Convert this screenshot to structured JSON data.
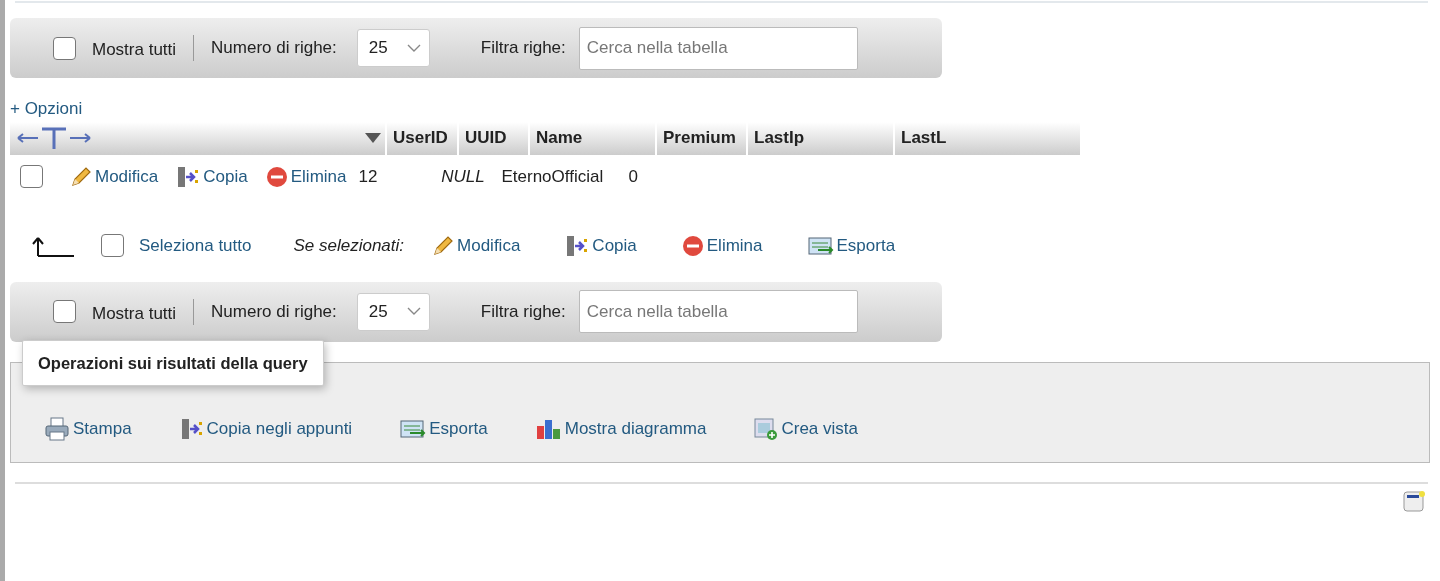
{
  "top_toolbar": {
    "show_all": {
      "label": "Mostra tutti",
      "checked": false
    },
    "rows_label": "Numero di righe:",
    "rows_value": "25",
    "filter_label": "Filtra righe:",
    "filter_placeholder": "Cerca nella tabella"
  },
  "options_link": "+ Opzioni",
  "table": {
    "columns": [
      "UserID",
      "UUID",
      "Name",
      "Premium",
      "LastIp",
      "LastL"
    ],
    "rows": [
      {
        "selected": false,
        "actions": [
          {
            "kind": "edit",
            "label": "Modifica"
          },
          {
            "kind": "copy",
            "label": "Copia"
          },
          {
            "kind": "delete",
            "label": "Elimina"
          }
        ],
        "cells": [
          {
            "text": "12",
            "kind": "value"
          },
          {
            "text": "NULL",
            "kind": "null"
          },
          {
            "text": "EternoOfficial",
            "kind": "value"
          },
          {
            "text": "0",
            "kind": "value"
          }
        ]
      }
    ]
  },
  "bulk_actions": {
    "select_all": {
      "label": "Seleziona tutto",
      "checked": false
    },
    "with_selected": "Se selezionati:",
    "actions": [
      {
        "kind": "edit",
        "label": "Modifica"
      },
      {
        "kind": "copy",
        "label": "Copia"
      },
      {
        "kind": "delete",
        "label": "Elimina"
      },
      {
        "kind": "export",
        "label": "Esporta"
      }
    ]
  },
  "bottom_toolbar": {
    "show_all": {
      "label": "Mostra tutti",
      "checked": false
    },
    "rows_label": "Numero di righe:",
    "rows_value": "25",
    "filter_label": "Filtra righe:",
    "filter_placeholder": "Cerca nella tabella"
  },
  "query_operations": {
    "title": "Operazioni sui risultati della query",
    "actions": [
      {
        "kind": "print",
        "label": "Stampa"
      },
      {
        "kind": "copy",
        "label": "Copia negli appunti"
      },
      {
        "kind": "export",
        "label": "Esporta"
      },
      {
        "kind": "chart",
        "label": "Mostra diagramma"
      },
      {
        "kind": "view",
        "label": "Crea vista"
      }
    ]
  }
}
